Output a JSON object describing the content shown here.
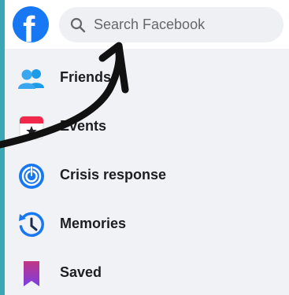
{
  "header": {
    "logo_letter": "f",
    "search_placeholder": "Search Facebook"
  },
  "menu": {
    "items": [
      {
        "label": "Friends",
        "icon": "friends-icon"
      },
      {
        "label": "Events",
        "icon": "calendar-star-icon"
      },
      {
        "label": "Crisis response",
        "icon": "crisis-response-icon"
      },
      {
        "label": "Memories",
        "icon": "memories-clock-icon"
      },
      {
        "label": "Saved",
        "icon": "bookmark-icon"
      }
    ]
  },
  "colors": {
    "brand_blue": "#1877f2",
    "background_border": "#3aa6b6",
    "text": "#1c1e21",
    "annotation_arrow": "#111111"
  }
}
